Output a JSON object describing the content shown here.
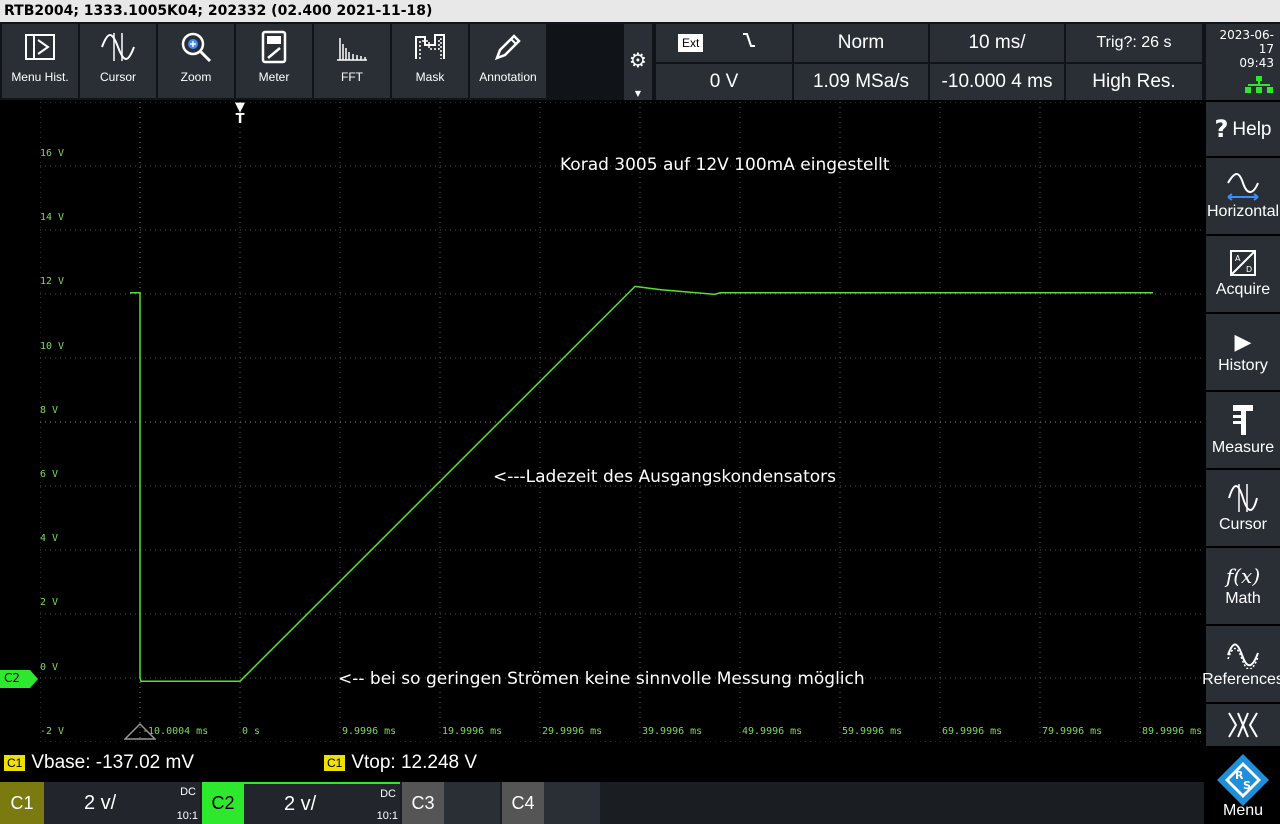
{
  "titlebar": "RTB2004; 1333.1005K04; 202332 (02.400 2021-11-18)",
  "toolbar": {
    "tools": [
      {
        "label": "Menu Hist.",
        "icon": "menu-hist-icon"
      },
      {
        "label": "Cursor",
        "icon": "cursor-wave-icon"
      },
      {
        "label": "Zoom",
        "icon": "zoom-icon"
      },
      {
        "label": "Meter",
        "icon": "meter-icon"
      },
      {
        "label": "FFT",
        "icon": "fft-icon"
      },
      {
        "label": "Mask",
        "icon": "mask-icon"
      },
      {
        "label": "Annotation",
        "icon": "pencil-icon"
      }
    ],
    "trigger_source": "Ext",
    "trigger_edge_icon": "falling-edge-icon",
    "trigger_mode": "Norm",
    "timebase": "10 ms/",
    "trig_status": "Trig?: 26 s",
    "trigger_level": "0 V",
    "sample_rate": "1.09 MSa/s",
    "horizontal_position": "-10.000 4 ms",
    "acq_mode": "High Res."
  },
  "datetime": {
    "date": "2023-06-17",
    "time": "09:43"
  },
  "sidebar": [
    {
      "label": "Help",
      "icon": "help-icon"
    },
    {
      "label": "Horizontal",
      "icon": "horizontal-icon"
    },
    {
      "label": "Acquire",
      "icon": "acquire-icon"
    },
    {
      "label": "History",
      "icon": "play-icon"
    },
    {
      "label": "Measure",
      "icon": "measure-icon"
    },
    {
      "label": "Cursor",
      "icon": "cursor-icon"
    },
    {
      "label": "Math",
      "icon": "math-icon"
    },
    {
      "label": "References",
      "icon": "references-icon"
    },
    {
      "label": "Menu",
      "icon": "rs-logo-icon"
    }
  ],
  "help_glyph": "?",
  "math_glyph": "f(x)",
  "axes": {
    "y_labels": [
      "16 V",
      "14 V",
      "12 V",
      "10 V",
      "8 V",
      "6 V",
      "4 V",
      "2 V",
      "0 V",
      "-2 V"
    ],
    "x_labels": [
      "-10.0004 ms",
      "0 s",
      "9.9996 ms",
      "19.9996 ms",
      "29.9996 ms",
      "39.9996 ms",
      "49.9996 ms",
      "59.9996 ms",
      "69.9996 ms",
      "79.9996 ms",
      "89.9996 ms"
    ]
  },
  "trigger_marker_label": "T",
  "channel_marker_label": "C2",
  "annotations": [
    "Korad 3005 auf 12V 100mA eingestellt",
    "<---Ladezeit des Ausgangskondensators",
    "<-- bei so geringen Strömen keine sinnvolle Messung möglich"
  ],
  "measurements": [
    {
      "badge": "C1",
      "text": "Vbase: -137.02 mV"
    },
    {
      "badge": "C1",
      "text": "Vtop: 12.248 V"
    }
  ],
  "channels": [
    {
      "name": "C1",
      "scale": "2 v/",
      "coupling": "DC",
      "probe": "10:1"
    },
    {
      "name": "C2",
      "scale": "2 v/",
      "coupling": "DC",
      "probe": "10:1"
    },
    {
      "name": "C3"
    },
    {
      "name": "C4"
    }
  ],
  "colors": {
    "trace": "#58e030",
    "c1": "#f0e000",
    "c2": "#2ee82e",
    "grid": "#5a5a5a",
    "label": "#7ddc5a"
  }
}
